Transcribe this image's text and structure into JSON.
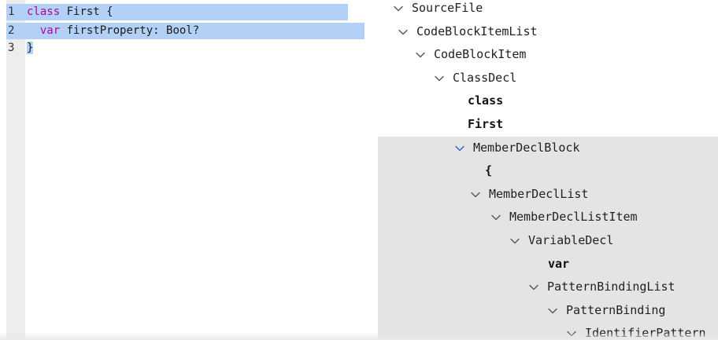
{
  "editor": {
    "lines": [
      {
        "number": "1",
        "tokens": [
          {
            "text": "class",
            "kind": "kw"
          },
          {
            "text": " First ",
            "kind": "plain"
          },
          {
            "text": "{",
            "kind": "plain"
          }
        ]
      },
      {
        "number": "2",
        "tokens": [
          {
            "text": "  ",
            "kind": "plain"
          },
          {
            "text": "var",
            "kind": "kw"
          },
          {
            "text": " firstProperty: Bool?",
            "kind": "plain"
          }
        ]
      },
      {
        "number": "3",
        "tokens": [
          {
            "text": "}",
            "kind": "plain"
          }
        ]
      }
    ]
  },
  "tree": {
    "nodes": [
      {
        "label": "SourceFile",
        "expanded": true
      },
      {
        "label": "CodeBlockItemList",
        "expanded": true
      },
      {
        "label": "CodeBlockItem",
        "expanded": true
      },
      {
        "label": "ClassDecl",
        "expanded": true
      },
      {
        "label": "class",
        "token": true
      },
      {
        "label": "First",
        "token": true
      },
      {
        "label": "MemberDeclBlock",
        "expanded": true,
        "active": true
      },
      {
        "label": "{",
        "token": true
      },
      {
        "label": "MemberDeclList",
        "expanded": true
      },
      {
        "label": "MemberDeclListItem",
        "expanded": true
      },
      {
        "label": "VariableDecl",
        "expanded": true
      },
      {
        "label": "var",
        "token": true
      },
      {
        "label": "PatternBindingList",
        "expanded": true
      },
      {
        "label": "PatternBinding",
        "expanded": true
      },
      {
        "label": "IdentifierPattern",
        "expanded": true
      }
    ]
  },
  "colors": {
    "keyword": "#b4009e",
    "selection": "#b3d1f7",
    "tree_highlight": "#e4e4e4",
    "active_chevron": "#2f5fd0"
  }
}
